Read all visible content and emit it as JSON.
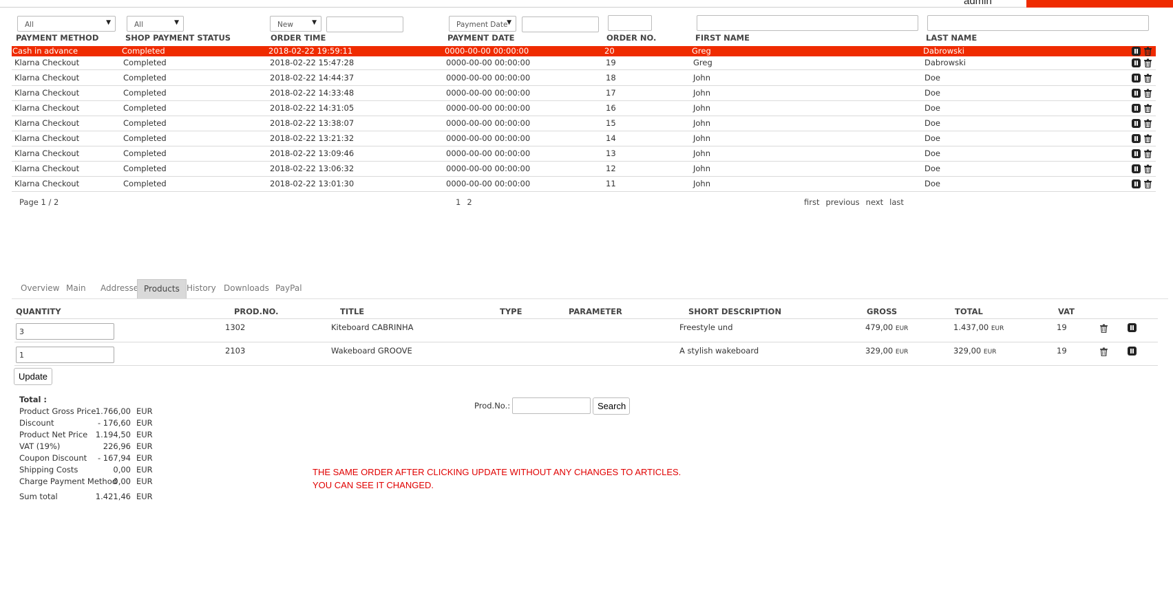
{
  "header": {
    "admin_label": "admin",
    "accent_color": "#ef2b00"
  },
  "filters": {
    "payment_method": "All",
    "shop_payment_status": "All",
    "order_time": "New",
    "payment_date": "Payment Date"
  },
  "columns": [
    "PAYMENT METHOD",
    "SHOP PAYMENT STATUS",
    "ORDER TIME",
    "PAYMENT DATE",
    "ORDER NO.",
    "FIRST NAME",
    "LAST NAME"
  ],
  "orders": [
    {
      "method": "Cash in advance",
      "status": "Completed",
      "time": "2018-02-22 19:59:11",
      "paydate": "0000-00-00 00:00:00",
      "no": "20",
      "first": "Greg",
      "last": "Dabrowski"
    },
    {
      "method": "Klarna Checkout",
      "status": "Completed",
      "time": "2018-02-22 15:47:28",
      "paydate": "0000-00-00 00:00:00",
      "no": "19",
      "first": "Greg",
      "last": "Dabrowski"
    },
    {
      "method": "Klarna Checkout",
      "status": "Completed",
      "time": "2018-02-22 14:44:37",
      "paydate": "0000-00-00 00:00:00",
      "no": "18",
      "first": "John",
      "last": "Doe"
    },
    {
      "method": "Klarna Checkout",
      "status": "Completed",
      "time": "2018-02-22 14:33:48",
      "paydate": "0000-00-00 00:00:00",
      "no": "17",
      "first": "John",
      "last": "Doe"
    },
    {
      "method": "Klarna Checkout",
      "status": "Completed",
      "time": "2018-02-22 14:31:05",
      "paydate": "0000-00-00 00:00:00",
      "no": "16",
      "first": "John",
      "last": "Doe"
    },
    {
      "method": "Klarna Checkout",
      "status": "Completed",
      "time": "2018-02-22 13:38:07",
      "paydate": "0000-00-00 00:00:00",
      "no": "15",
      "first": "John",
      "last": "Doe"
    },
    {
      "method": "Klarna Checkout",
      "status": "Completed",
      "time": "2018-02-22 13:21:32",
      "paydate": "0000-00-00 00:00:00",
      "no": "14",
      "first": "John",
      "last": "Doe"
    },
    {
      "method": "Klarna Checkout",
      "status": "Completed",
      "time": "2018-02-22 13:09:46",
      "paydate": "0000-00-00 00:00:00",
      "no": "13",
      "first": "John",
      "last": "Doe"
    },
    {
      "method": "Klarna Checkout",
      "status": "Completed",
      "time": "2018-02-22 13:06:32",
      "paydate": "0000-00-00 00:00:00",
      "no": "12",
      "first": "John",
      "last": "Doe"
    },
    {
      "method": "Klarna Checkout",
      "status": "Completed",
      "time": "2018-02-22 13:01:30",
      "paydate": "0000-00-00 00:00:00",
      "no": "11",
      "first": "John",
      "last": "Doe"
    }
  ],
  "pager": {
    "page_info": "Page 1 / 2",
    "pages": [
      "1",
      "2"
    ],
    "first": "first",
    "previous": "previous",
    "next": "next",
    "last": "last"
  },
  "tabs": [
    "Overview",
    "Main",
    "Addresses",
    "Products",
    "History",
    "Downloads",
    "PayPal"
  ],
  "active_tab": "Products",
  "product_columns": [
    "QUANTITY",
    "PROD.NO.",
    "TITLE",
    "TYPE",
    "PARAMETER",
    "SHORT DESCRIPTION",
    "GROSS",
    "TOTAL",
    "VAT"
  ],
  "products": [
    {
      "qty": "3",
      "prodno": "1302",
      "title": "Kiteboard CABRINHA",
      "type": "",
      "parameter": "",
      "desc": "Freestyle und",
      "gross": "479,00",
      "total": "1.437,00",
      "currency": "EUR",
      "vat": "19"
    },
    {
      "qty": "1",
      "prodno": "2103",
      "title": "Wakeboard GROOVE",
      "type": "",
      "parameter": "",
      "desc": "A stylish wakeboard",
      "gross": "329,00",
      "total": "329,00",
      "currency": "EUR",
      "vat": "19"
    }
  ],
  "update_label": "Update",
  "search": {
    "label": "Prod.No.:",
    "value": "",
    "button": "Search"
  },
  "totals": {
    "title": "Total :",
    "currency": "EUR",
    "rows": [
      {
        "label": "Product Gross Price",
        "value": "1.766,00"
      },
      {
        "label": "Discount",
        "value": "- 176,60"
      },
      {
        "label": "Product Net Price",
        "value": "1.194,50"
      },
      {
        "label": "VAT (19%)",
        "value": "226,96"
      },
      {
        "label": "Coupon Discount",
        "value": "- 167,94"
      },
      {
        "label": "Shipping Costs",
        "value": "0,00"
      },
      {
        "label": "Charge Payment Method",
        "value": "0,00"
      }
    ],
    "sum": {
      "label": "Sum total",
      "value": "1.421,46"
    }
  },
  "note": {
    "line1": "THE SAME ORDER AFTER CLICKING UPDATE WITHOUT ANY CHANGES TO ARTICLES.",
    "line2": "YOU CAN SEE IT CHANGED.",
    "color": "#e00000"
  }
}
